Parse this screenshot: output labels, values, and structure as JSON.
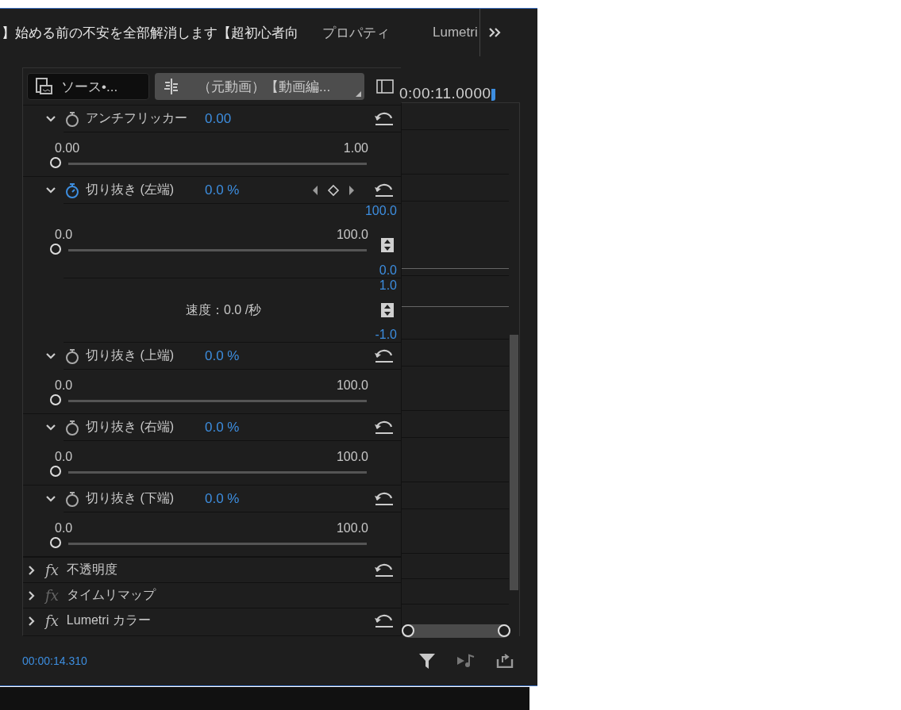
{
  "tabs": [
    {
      "label": "】始める前の不安を全部解消します【超初心者向",
      "selected": true
    },
    {
      "label": "プロパティ",
      "selected": false
    },
    {
      "label": "Lumetri",
      "selected": false
    }
  ],
  "clip_tabs": [
    {
      "label": "ソース•...",
      "selected": false,
      "kind": "source"
    },
    {
      "label": "（元動画）【動画編...",
      "selected": true,
      "kind": "sequence"
    }
  ],
  "playhead_time": "0:00:11.0000",
  "items": [
    {
      "kind": "param",
      "name": "アンチフリッカー",
      "value": "0.00",
      "stopwatch_on": false,
      "expanded": true,
      "min": "0.00",
      "max": "1.00",
      "level": 0
    },
    {
      "kind": "param",
      "name": "切り抜き (左端)",
      "value": "0.0 %",
      "stopwatch_on": true,
      "keyframe_nav": true,
      "expanded": true,
      "min": "0.0",
      "max": "100.0",
      "level": 0,
      "graph_max": "100.0",
      "graph_min": "0.0",
      "velocity": "速度：0.0 /秒",
      "velocity_max": "1.0",
      "velocity_min": "-1.0"
    },
    {
      "kind": "param",
      "name": "切り抜き (上端)",
      "value": "0.0 %",
      "stopwatch_on": false,
      "expanded": true,
      "min": "0.0",
      "max": "100.0",
      "level": 0
    },
    {
      "kind": "param",
      "name": "切り抜き (右端)",
      "value": "0.0 %",
      "stopwatch_on": false,
      "expanded": true,
      "min": "0.0",
      "max": "100.0",
      "level": 0
    },
    {
      "kind": "param",
      "name": "切り抜き (下端)",
      "value": "0.0 %",
      "stopwatch_on": false,
      "expanded": true,
      "min": "0.0",
      "max": "100.0",
      "level": 0
    },
    {
      "kind": "effect",
      "badge": "fx",
      "name": "不透明度",
      "enabled": true,
      "resettable": true,
      "expanded": false
    },
    {
      "kind": "effect",
      "badge": "fx",
      "name": "タイムリマップ",
      "enabled": false,
      "resettable": false,
      "expanded": false
    },
    {
      "kind": "effect",
      "badge": "fx",
      "name": "Lumetri カラー",
      "enabled": true,
      "resettable": true,
      "expanded": false
    }
  ],
  "current_time": "00:00:14.310"
}
